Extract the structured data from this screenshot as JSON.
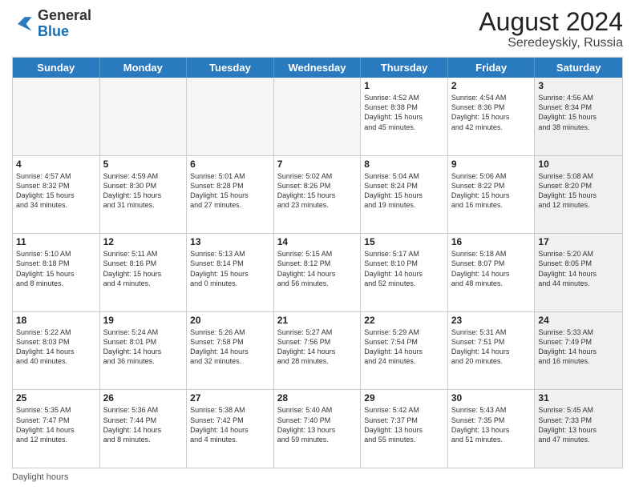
{
  "header": {
    "logo_general": "General",
    "logo_blue": "Blue",
    "month_year": "August 2024",
    "location": "Seredeyskiy, Russia"
  },
  "weekdays": [
    "Sunday",
    "Monday",
    "Tuesday",
    "Wednesday",
    "Thursday",
    "Friday",
    "Saturday"
  ],
  "footer": {
    "daylight_label": "Daylight hours"
  },
  "rows": [
    {
      "cells": [
        {
          "empty": true,
          "day": "",
          "text": ""
        },
        {
          "empty": true,
          "day": "",
          "text": ""
        },
        {
          "empty": true,
          "day": "",
          "text": ""
        },
        {
          "empty": true,
          "day": "",
          "text": ""
        },
        {
          "day": "1",
          "text": "Sunrise: 4:52 AM\nSunset: 8:38 PM\nDaylight: 15 hours\nand 45 minutes."
        },
        {
          "day": "2",
          "text": "Sunrise: 4:54 AM\nSunset: 8:36 PM\nDaylight: 15 hours\nand 42 minutes."
        },
        {
          "day": "3",
          "shaded": true,
          "text": "Sunrise: 4:56 AM\nSunset: 8:34 PM\nDaylight: 15 hours\nand 38 minutes."
        }
      ]
    },
    {
      "cells": [
        {
          "day": "4",
          "text": "Sunrise: 4:57 AM\nSunset: 8:32 PM\nDaylight: 15 hours\nand 34 minutes."
        },
        {
          "day": "5",
          "text": "Sunrise: 4:59 AM\nSunset: 8:30 PM\nDaylight: 15 hours\nand 31 minutes."
        },
        {
          "day": "6",
          "text": "Sunrise: 5:01 AM\nSunset: 8:28 PM\nDaylight: 15 hours\nand 27 minutes."
        },
        {
          "day": "7",
          "text": "Sunrise: 5:02 AM\nSunset: 8:26 PM\nDaylight: 15 hours\nand 23 minutes."
        },
        {
          "day": "8",
          "text": "Sunrise: 5:04 AM\nSunset: 8:24 PM\nDaylight: 15 hours\nand 19 minutes."
        },
        {
          "day": "9",
          "text": "Sunrise: 5:06 AM\nSunset: 8:22 PM\nDaylight: 15 hours\nand 16 minutes."
        },
        {
          "day": "10",
          "shaded": true,
          "text": "Sunrise: 5:08 AM\nSunset: 8:20 PM\nDaylight: 15 hours\nand 12 minutes."
        }
      ]
    },
    {
      "cells": [
        {
          "day": "11",
          "text": "Sunrise: 5:10 AM\nSunset: 8:18 PM\nDaylight: 15 hours\nand 8 minutes."
        },
        {
          "day": "12",
          "text": "Sunrise: 5:11 AM\nSunset: 8:16 PM\nDaylight: 15 hours\nand 4 minutes."
        },
        {
          "day": "13",
          "text": "Sunrise: 5:13 AM\nSunset: 8:14 PM\nDaylight: 15 hours\nand 0 minutes."
        },
        {
          "day": "14",
          "text": "Sunrise: 5:15 AM\nSunset: 8:12 PM\nDaylight: 14 hours\nand 56 minutes."
        },
        {
          "day": "15",
          "text": "Sunrise: 5:17 AM\nSunset: 8:10 PM\nDaylight: 14 hours\nand 52 minutes."
        },
        {
          "day": "16",
          "text": "Sunrise: 5:18 AM\nSunset: 8:07 PM\nDaylight: 14 hours\nand 48 minutes."
        },
        {
          "day": "17",
          "shaded": true,
          "text": "Sunrise: 5:20 AM\nSunset: 8:05 PM\nDaylight: 14 hours\nand 44 minutes."
        }
      ]
    },
    {
      "cells": [
        {
          "day": "18",
          "text": "Sunrise: 5:22 AM\nSunset: 8:03 PM\nDaylight: 14 hours\nand 40 minutes."
        },
        {
          "day": "19",
          "text": "Sunrise: 5:24 AM\nSunset: 8:01 PM\nDaylight: 14 hours\nand 36 minutes."
        },
        {
          "day": "20",
          "text": "Sunrise: 5:26 AM\nSunset: 7:58 PM\nDaylight: 14 hours\nand 32 minutes."
        },
        {
          "day": "21",
          "text": "Sunrise: 5:27 AM\nSunset: 7:56 PM\nDaylight: 14 hours\nand 28 minutes."
        },
        {
          "day": "22",
          "text": "Sunrise: 5:29 AM\nSunset: 7:54 PM\nDaylight: 14 hours\nand 24 minutes."
        },
        {
          "day": "23",
          "text": "Sunrise: 5:31 AM\nSunset: 7:51 PM\nDaylight: 14 hours\nand 20 minutes."
        },
        {
          "day": "24",
          "shaded": true,
          "text": "Sunrise: 5:33 AM\nSunset: 7:49 PM\nDaylight: 14 hours\nand 16 minutes."
        }
      ]
    },
    {
      "cells": [
        {
          "day": "25",
          "text": "Sunrise: 5:35 AM\nSunset: 7:47 PM\nDaylight: 14 hours\nand 12 minutes."
        },
        {
          "day": "26",
          "text": "Sunrise: 5:36 AM\nSunset: 7:44 PM\nDaylight: 14 hours\nand 8 minutes."
        },
        {
          "day": "27",
          "text": "Sunrise: 5:38 AM\nSunset: 7:42 PM\nDaylight: 14 hours\nand 4 minutes."
        },
        {
          "day": "28",
          "text": "Sunrise: 5:40 AM\nSunset: 7:40 PM\nDaylight: 13 hours\nand 59 minutes."
        },
        {
          "day": "29",
          "text": "Sunrise: 5:42 AM\nSunset: 7:37 PM\nDaylight: 13 hours\nand 55 minutes."
        },
        {
          "day": "30",
          "text": "Sunrise: 5:43 AM\nSunset: 7:35 PM\nDaylight: 13 hours\nand 51 minutes."
        },
        {
          "day": "31",
          "shaded": true,
          "text": "Sunrise: 5:45 AM\nSunset: 7:33 PM\nDaylight: 13 hours\nand 47 minutes."
        }
      ]
    }
  ]
}
